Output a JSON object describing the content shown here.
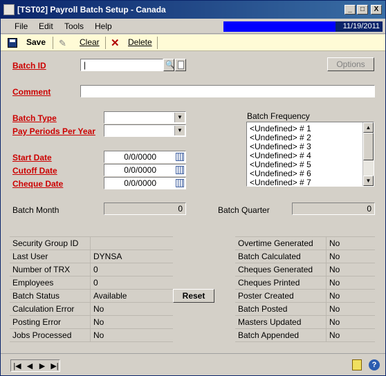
{
  "window": {
    "title": "[TST02] Payroll Batch Setup - Canada",
    "min": "_",
    "max": "□",
    "close": "X"
  },
  "menu": {
    "items": [
      "File",
      "Edit",
      "Tools",
      "Help"
    ],
    "date": "11/19/2011"
  },
  "toolbar": {
    "save": "Save",
    "clear": "Clear",
    "delete": "Delete"
  },
  "batch_id": {
    "label": "Batch ID",
    "value": "|"
  },
  "options_button": "Options",
  "comment": {
    "label": "Comment",
    "value": ""
  },
  "batch_type": {
    "label": "Batch Type",
    "value": ""
  },
  "pay_periods": {
    "label": "Pay Periods Per Year",
    "value": ""
  },
  "start_date": {
    "label": "Start Date",
    "value": "0/0/0000"
  },
  "cutoff_date": {
    "label": "Cutoff Date",
    "value": "0/0/0000"
  },
  "cheque_date": {
    "label": "Cheque Date",
    "value": "0/0/0000"
  },
  "batch_frequency": {
    "label": "Batch Frequency",
    "items": [
      "<Undefined> # 1",
      "<Undefined> # 2",
      "<Undefined> # 3",
      "<Undefined> # 4",
      "<Undefined> # 5",
      "<Undefined> # 6",
      "<Undefined> # 7"
    ]
  },
  "batch_month": {
    "label": "Batch Month",
    "value": "0"
  },
  "batch_quarter": {
    "label": "Batch Quarter",
    "value": "0"
  },
  "left_grid": [
    {
      "label": "Security Group ID",
      "value": ""
    },
    {
      "label": "Last User",
      "value": "DYNSA"
    },
    {
      "label": "Number of TRX",
      "value": "0"
    },
    {
      "label": "Employees",
      "value": "0"
    },
    {
      "label": "Batch Status",
      "value": "Available"
    },
    {
      "label": "Calculation Error",
      "value": "No"
    },
    {
      "label": "Posting Error",
      "value": "No"
    },
    {
      "label": "Jobs Processed",
      "value": "No"
    }
  ],
  "reset_button": "Reset",
  "right_grid": [
    {
      "label": "Overtime Generated",
      "value": "No"
    },
    {
      "label": "Batch Calculated",
      "value": "No"
    },
    {
      "label": "Cheques Generated",
      "value": "No"
    },
    {
      "label": "Cheques Printed",
      "value": "No"
    },
    {
      "label": "Poster Created",
      "value": "No"
    },
    {
      "label": "Batch Posted",
      "value": "No"
    },
    {
      "label": "Masters Updated",
      "value": "No"
    },
    {
      "label": "Batch Appended",
      "value": "No"
    }
  ],
  "nav": {
    "first": "|◀",
    "prev": "◀",
    "next": "▶",
    "last": "▶|"
  }
}
